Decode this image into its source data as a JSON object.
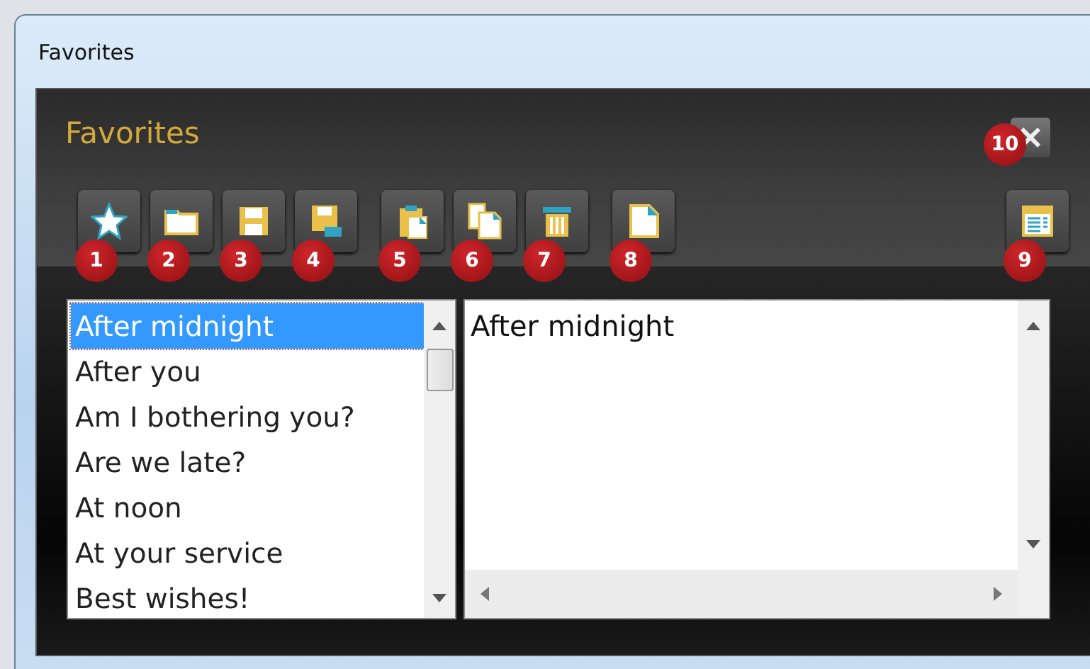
{
  "window": {
    "title": "Favorites"
  },
  "panel": {
    "title": "Favorites",
    "close_button": {
      "badge": "10"
    }
  },
  "toolbar": {
    "groups": [
      [
        {
          "kind": "star",
          "badge": "1"
        },
        {
          "kind": "folder",
          "badge": "2"
        },
        {
          "kind": "save",
          "badge": "3"
        },
        {
          "kind": "save-as",
          "badge": "4"
        }
      ],
      [
        {
          "kind": "paste",
          "badge": "5"
        },
        {
          "kind": "copy",
          "badge": "6"
        },
        {
          "kind": "delete",
          "badge": "7"
        }
      ],
      [
        {
          "kind": "new",
          "badge": "8"
        }
      ]
    ],
    "right_buttons": [
      {
        "kind": "view",
        "badge": "9"
      }
    ]
  },
  "list": {
    "items": [
      {
        "label": "After midnight",
        "selected": true
      },
      {
        "label": "After you",
        "selected": false
      },
      {
        "label": "Am I bothering you?",
        "selected": false
      },
      {
        "label": "Are we late?",
        "selected": false
      },
      {
        "label": "At noon",
        "selected": false
      },
      {
        "label": "At your service",
        "selected": false
      },
      {
        "label": "Best wishes!",
        "selected": false
      }
    ]
  },
  "text_area": {
    "value": "After midnight"
  }
}
